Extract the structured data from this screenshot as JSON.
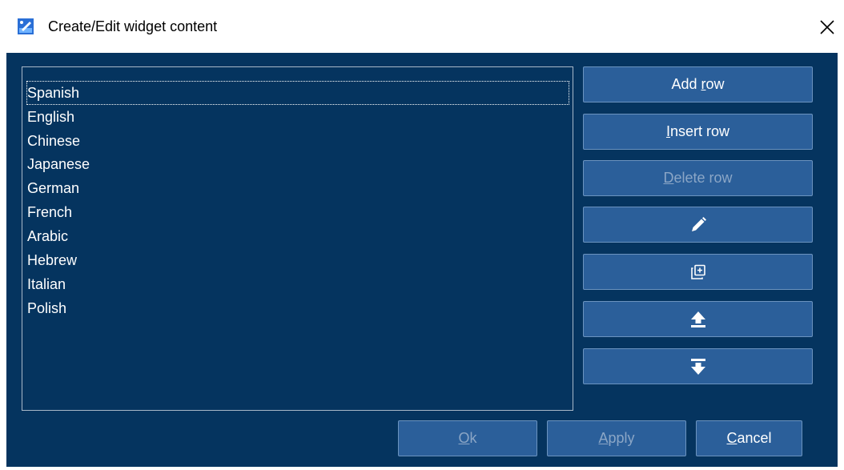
{
  "window": {
    "title": "Create/Edit widget content",
    "close_icon": "close-icon",
    "app_icon": "paint-app-icon"
  },
  "list": {
    "items": [
      "Spanish",
      "English",
      "Chinese",
      "Japanese",
      "German",
      "French",
      "Arabic",
      "Hebrew",
      "Italian",
      "Polish"
    ],
    "focused_index": 0
  },
  "buttons": {
    "add_row": {
      "pre": "Add ",
      "key": "r",
      "post": "ow"
    },
    "insert_row": {
      "pre": "",
      "key": "I",
      "post": "nsert row"
    },
    "delete_row": {
      "pre": "",
      "key": "D",
      "post": "elete row"
    },
    "edit_icon": "pencil-icon",
    "duplicate_icon": "duplicate-add-icon",
    "move_up_icon": "arrow-up-bar-icon",
    "move_down_icon": "arrow-down-bar-icon",
    "ok": {
      "pre": "",
      "key": "O",
      "post": "k"
    },
    "apply": {
      "pre": "",
      "key": "A",
      "post": "pply"
    },
    "cancel": {
      "pre": "",
      "key": "C",
      "post": "ancel"
    }
  },
  "colors": {
    "background": "#05345f",
    "button": "#2b5f9a",
    "disabled_text": "#8ba6c6"
  }
}
